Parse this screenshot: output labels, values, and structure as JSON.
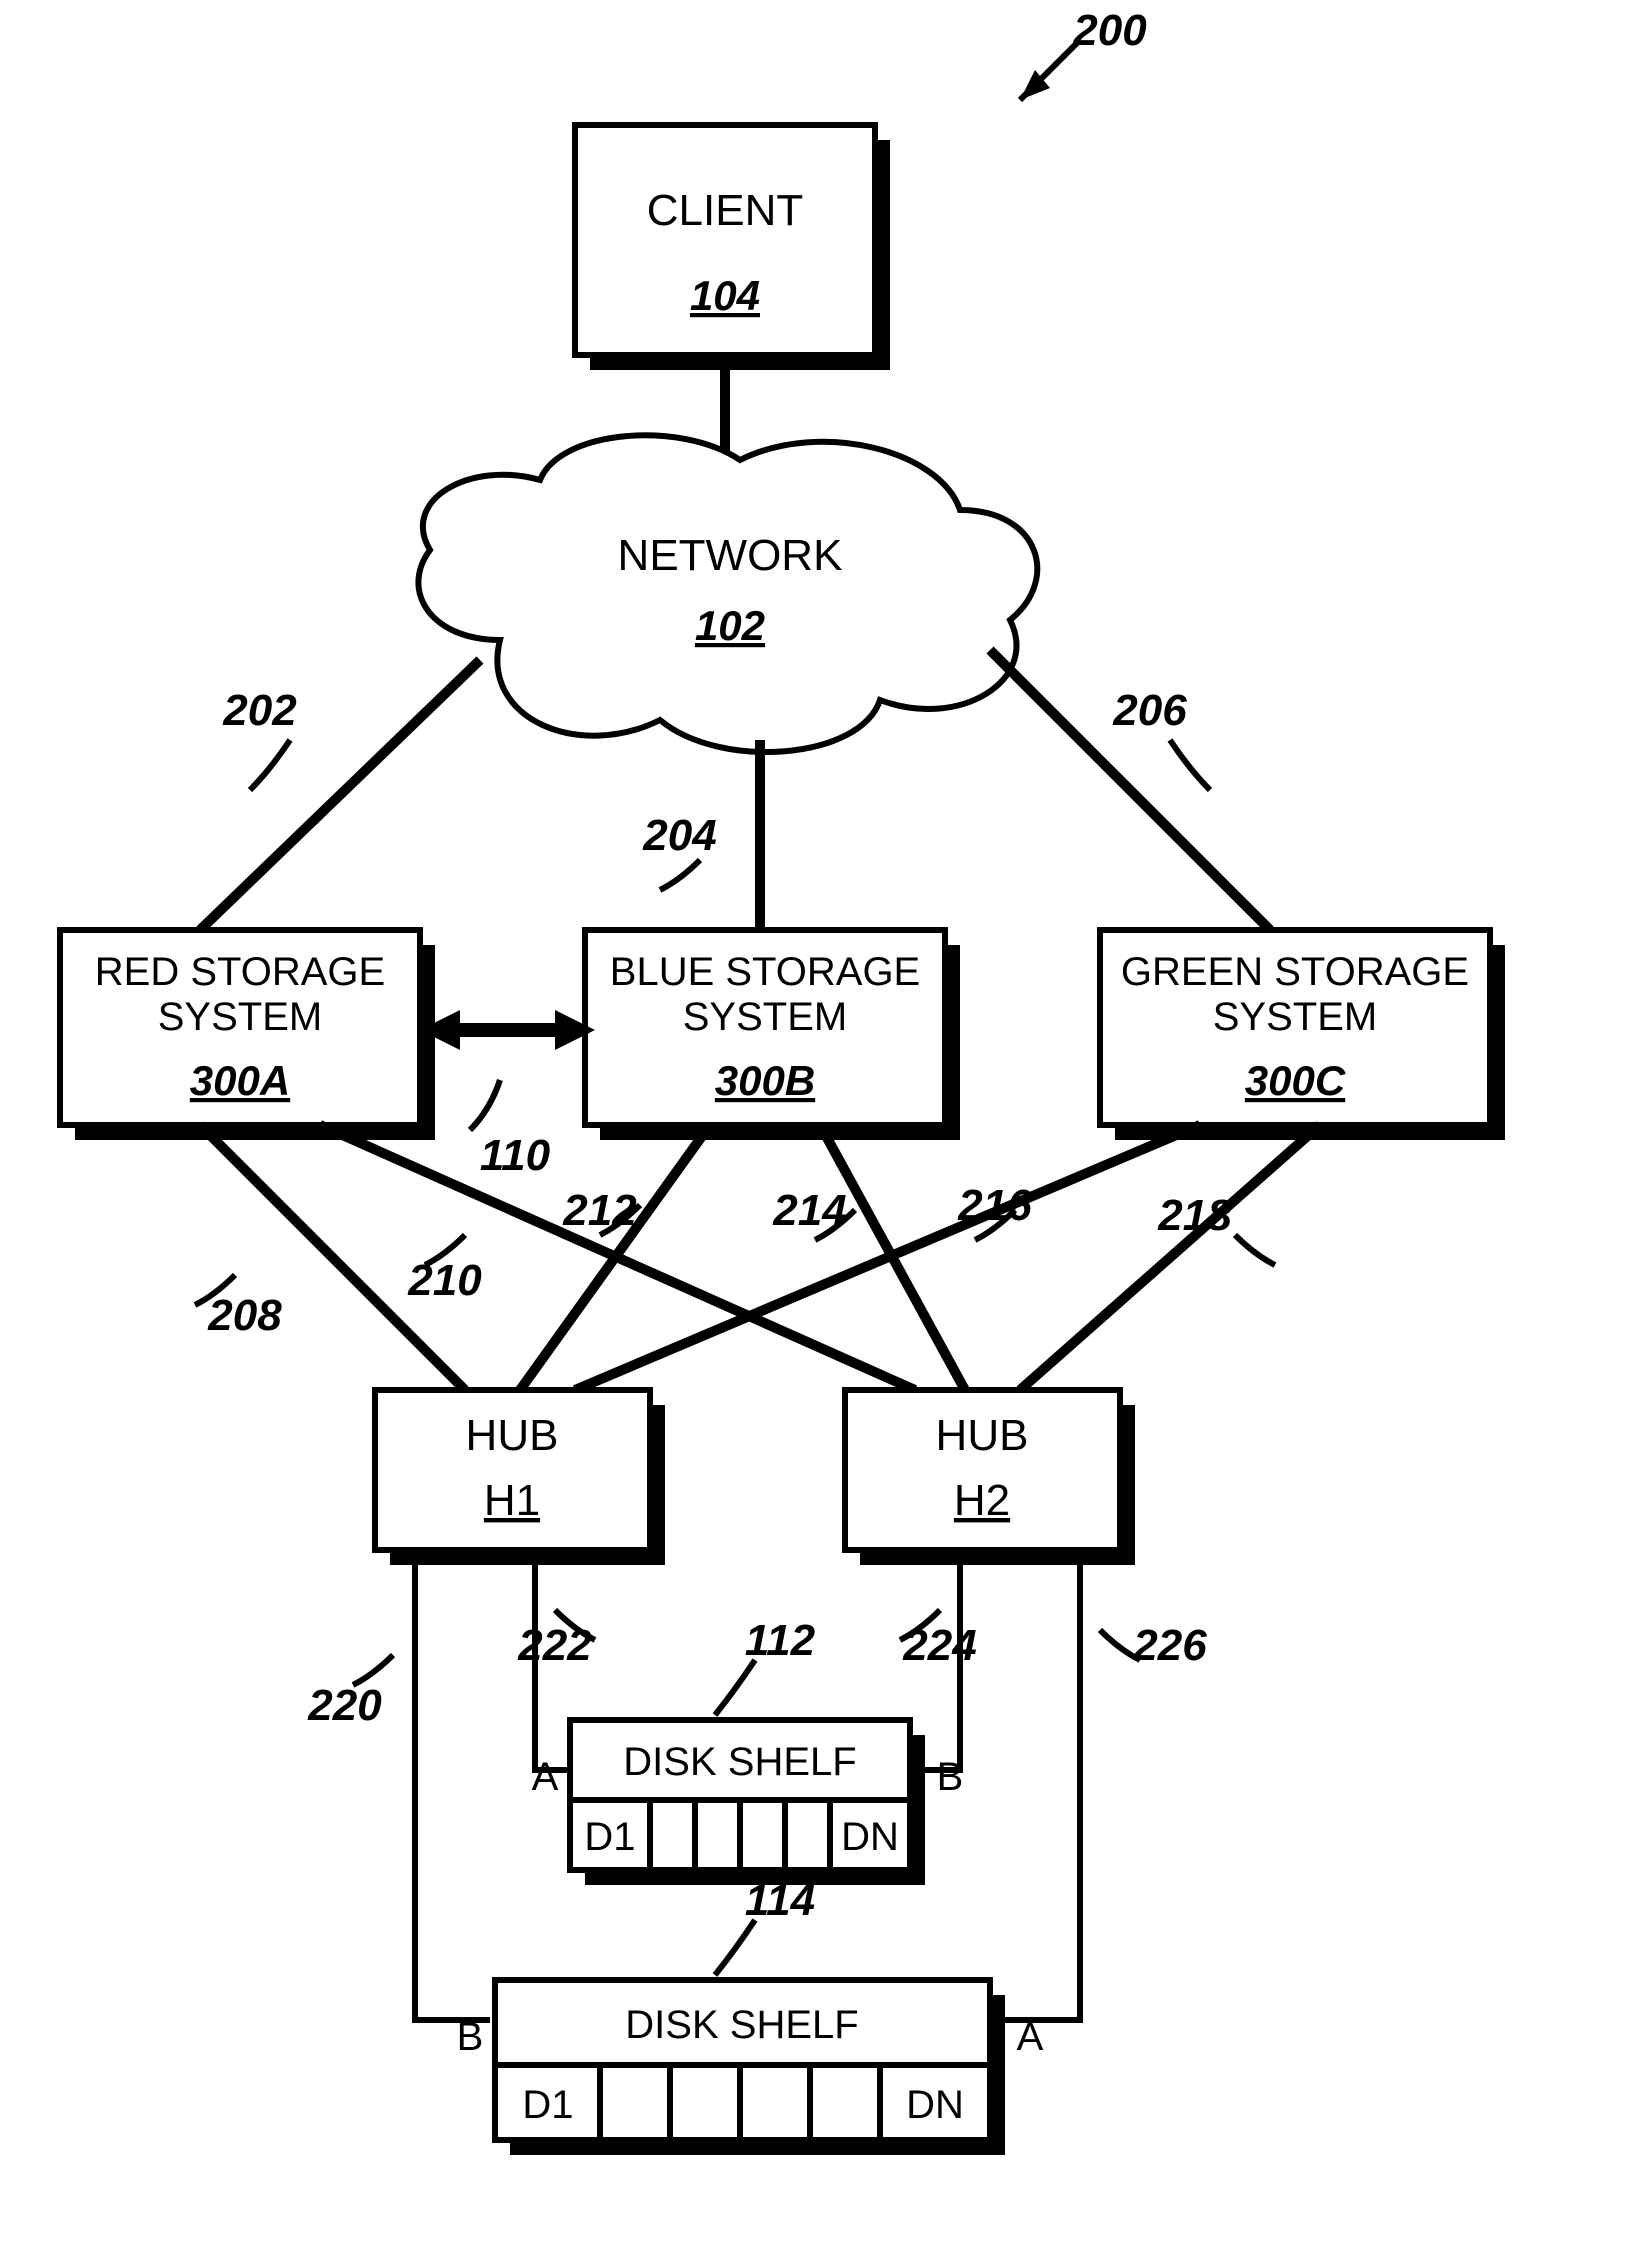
{
  "figure_ref": "200",
  "client": {
    "label": "CLIENT",
    "ref": "104"
  },
  "network": {
    "label": "NETWORK",
    "ref": "102"
  },
  "links_network_to_storage": {
    "left": "202",
    "center": "204",
    "right": "206"
  },
  "interconnect": "110",
  "storage": {
    "red": {
      "line1": "RED STORAGE",
      "line2": "SYSTEM",
      "ref": "300A"
    },
    "blue": {
      "line1": "BLUE STORAGE",
      "line2": "SYSTEM",
      "ref": "300B"
    },
    "green": {
      "line1": "GREEN  STORAGE",
      "line2": "SYSTEM",
      "ref": "300C"
    }
  },
  "links_storage_to_hub": {
    "l208": "208",
    "l210": "210",
    "l212": "212",
    "l214": "214",
    "l216": "216",
    "l218": "218"
  },
  "hubs": {
    "h1": {
      "label": "HUB",
      "ref": "H1"
    },
    "h2": {
      "label": "HUB",
      "ref": "H2"
    }
  },
  "links_hub_to_shelf": {
    "l220": "220",
    "l222": "222",
    "l224": "224",
    "l226": "226"
  },
  "shelves": {
    "s1": {
      "label": "DISK SHELF",
      "ref": "112",
      "portA": "A",
      "portB": "B",
      "d_first": "D1",
      "d_last": "DN"
    },
    "s2": {
      "label": "DISK SHELF",
      "ref": "114",
      "portA": "A",
      "portB": "B",
      "d_first": "D1",
      "d_last": "DN"
    }
  }
}
